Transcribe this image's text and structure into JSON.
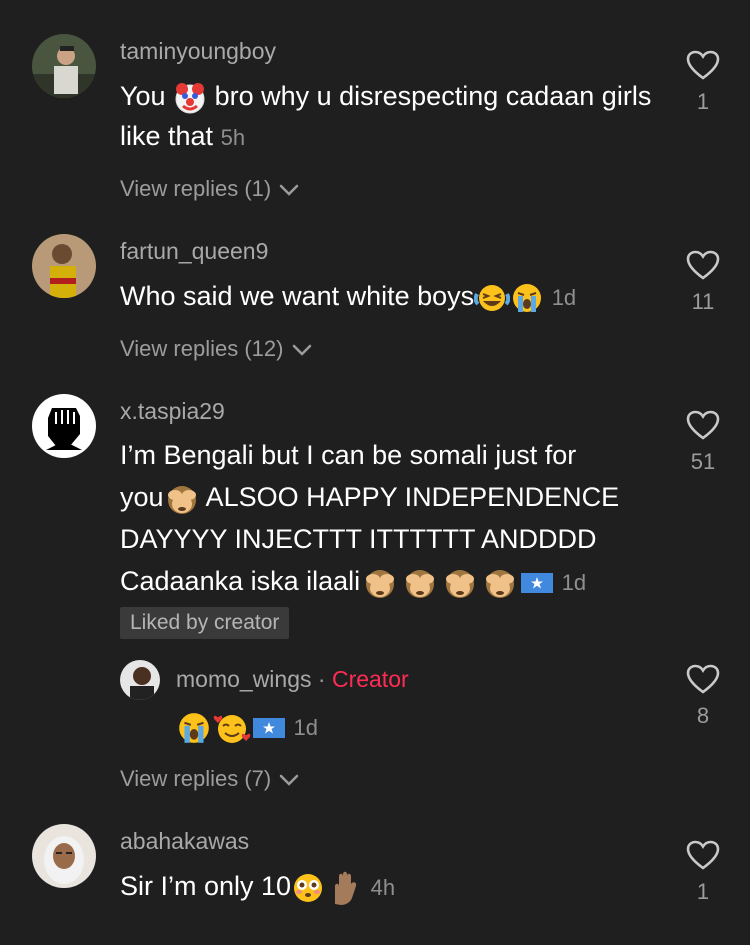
{
  "comments": [
    {
      "username": "taminyoungboy",
      "text_before": "You",
      "text_after": " bro why u disrespecting cadaan girls like that",
      "time": "5h",
      "likes": "1",
      "view_replies": "View replies (1)"
    },
    {
      "username": "fartun_queen9",
      "text": "Who said we want white boys",
      "time": "1d",
      "likes": "11",
      "view_replies": "View replies (12)"
    },
    {
      "username": "x.taspia29",
      "line1": "I’m Bengali but I can be somali just for",
      "line2a": "you",
      "line2b": " ALSOO HAPPY INDEPENDENCE",
      "line3": "DAYYYY INJECTTT ITTTTTT ANDDDD",
      "line4": "Cadaanka iska ilaali",
      "time": "1d",
      "likes": "51",
      "badge": "Liked by creator"
    },
    {
      "username": "momo_wings",
      "separator": "·",
      "creator_label": "Creator",
      "time": "1d",
      "likes": "8",
      "view_replies": "View replies (7)"
    },
    {
      "username": "abahakawas",
      "text": "Sir I’m only 10",
      "time": "4h",
      "likes": "1"
    }
  ],
  "icons": {
    "heart": "heart-outline-icon",
    "chevron": "chevron-down-icon"
  },
  "colors": {
    "background": "#1f1f1f",
    "creator": "#fe2c55",
    "muted": "#9c9c9c"
  }
}
